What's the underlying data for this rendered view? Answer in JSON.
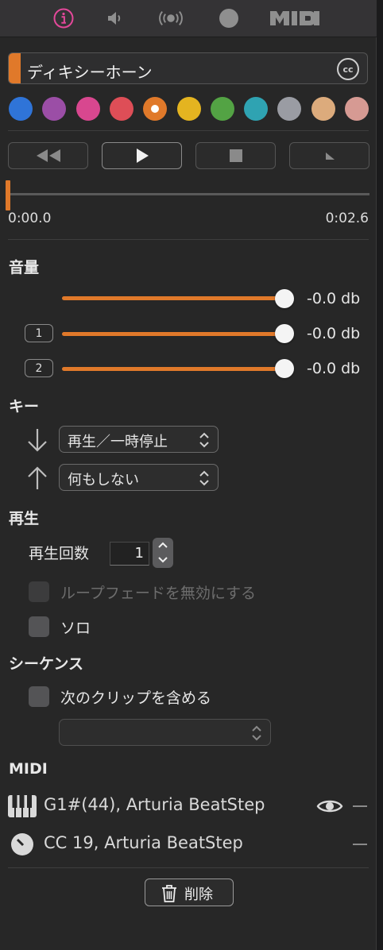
{
  "tabs": [
    {
      "icon": "info-icon",
      "active": true
    },
    {
      "icon": "speaker-icon"
    },
    {
      "icon": "broadcast-icon"
    },
    {
      "icon": "record-dot-icon"
    },
    {
      "icon": "midi-icon",
      "label": "MIDI"
    }
  ],
  "clip": {
    "name": "ディキシーホーン",
    "badge": "cc",
    "color": "#e0792a"
  },
  "colors": [
    "#2f74d8",
    "#9b4ea6",
    "#d8478f",
    "#de4e57",
    "#e0792a",
    "#e4b420",
    "#53a344",
    "#2fa3b2",
    "#9a9ca3",
    "#dcab7c",
    "#d69a93"
  ],
  "selected_color_index": 4,
  "transport": {
    "buttons": [
      "rewind-icon",
      "play-icon",
      "stop-icon",
      "fade-icon"
    ]
  },
  "playhead": {
    "start": "0:00.0",
    "end": "0:02.6",
    "position": 0.0
  },
  "volume": {
    "title": "音量",
    "rows": [
      {
        "badge": "",
        "db": "-0.0 db",
        "level": 1.0
      },
      {
        "badge": "1",
        "db": "-0.0 db",
        "level": 1.0
      },
      {
        "badge": "2",
        "db": "-0.0 db",
        "level": 1.0
      }
    ]
  },
  "key": {
    "title": "キー",
    "down_action": "再生／一時停止",
    "up_action": "何もしない"
  },
  "playback": {
    "title": "再生",
    "count_label": "再生回数",
    "count_value": "1",
    "loop_fade_label": "ループフェードを無効にする",
    "solo_label": "ソロ"
  },
  "sequence": {
    "title": "シーケンス",
    "include_next_label": "次のクリップを含める",
    "next_clip_value": ""
  },
  "midi": {
    "title": "MIDI",
    "rows": [
      {
        "icon": "piano-keys-icon",
        "text": "G1#(44), Arturia BeatStep",
        "watch": true
      },
      {
        "icon": "knob-icon",
        "text": "CC 19, Arturia BeatStep",
        "watch": false
      }
    ]
  },
  "delete_label": "削除",
  "accent": "#e0792a"
}
